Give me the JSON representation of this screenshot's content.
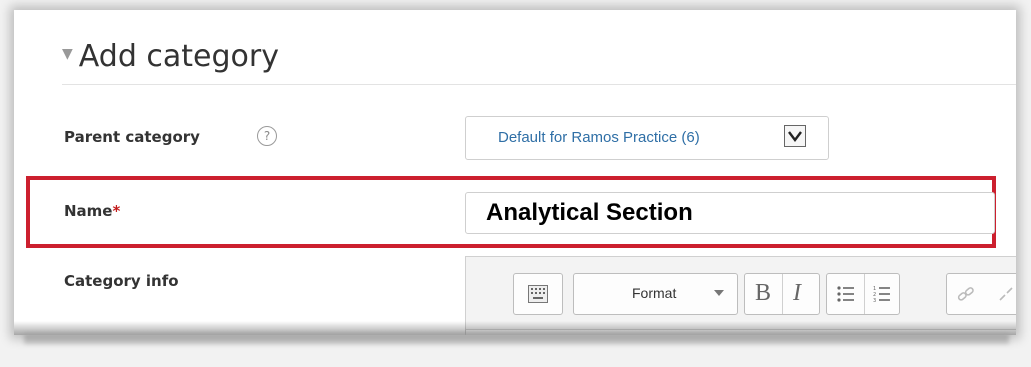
{
  "section": {
    "title": "Add category",
    "expanded_icon": "triangle-down-icon"
  },
  "parent_category": {
    "label": "Parent category",
    "help_icon": "help-circle-icon",
    "help_glyph": "?",
    "selected": "Default for Ramos Practice (6)"
  },
  "name_field": {
    "label": "Name",
    "required_mark": "*",
    "value": "Analytical Section",
    "highlight_color": "#cc1f2e"
  },
  "category_info": {
    "label": "Category info",
    "toolbar": {
      "format_label": "Format",
      "bold_glyph": "B",
      "italic_glyph": "I"
    }
  },
  "colors": {
    "link_blue": "#2f6fa6",
    "required_red": "#c31c1c"
  }
}
